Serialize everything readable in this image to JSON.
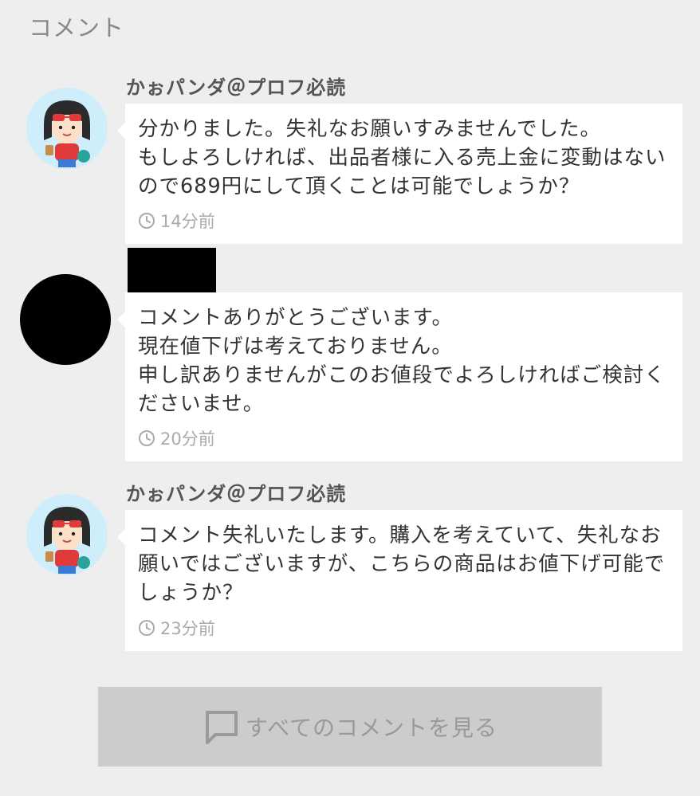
{
  "section": {
    "title": "コメント"
  },
  "comments": [
    {
      "user": "かぉパンダ＠プロフ必読",
      "avatar": "girl-avatar-icon",
      "text": "分かりました。失礼なお願いすみませんでした。\nもしよろしければ、出品者様に入る売上金に変動はないので689円にして頂くことは可能でしょうか？",
      "time": "14分前"
    },
    {
      "user": "",
      "avatar": "redacted-avatar",
      "text": "コメントありがとうございます。\n現在値下げは考えておりません。\n申し訳ありませんがこのお値段でよろしければご検討くださいませ。",
      "time": "20分前"
    },
    {
      "user": "かぉパンダ＠プロフ必読",
      "avatar": "girl-avatar-icon",
      "text": "コメント失礼いたします。購入を考えていて、失礼なお願いではございますが、こちらの商品はお値下げ可能でしょうか？",
      "time": "23分前"
    }
  ],
  "footer": {
    "view_all_label": "すべてのコメントを見る",
    "view_all_icon": "chat-bubble-icon"
  },
  "colors": {
    "background": "#eeeeee",
    "bubble": "#ffffff",
    "button": "#cccccc",
    "muted_text": "#aaaaaa"
  }
}
